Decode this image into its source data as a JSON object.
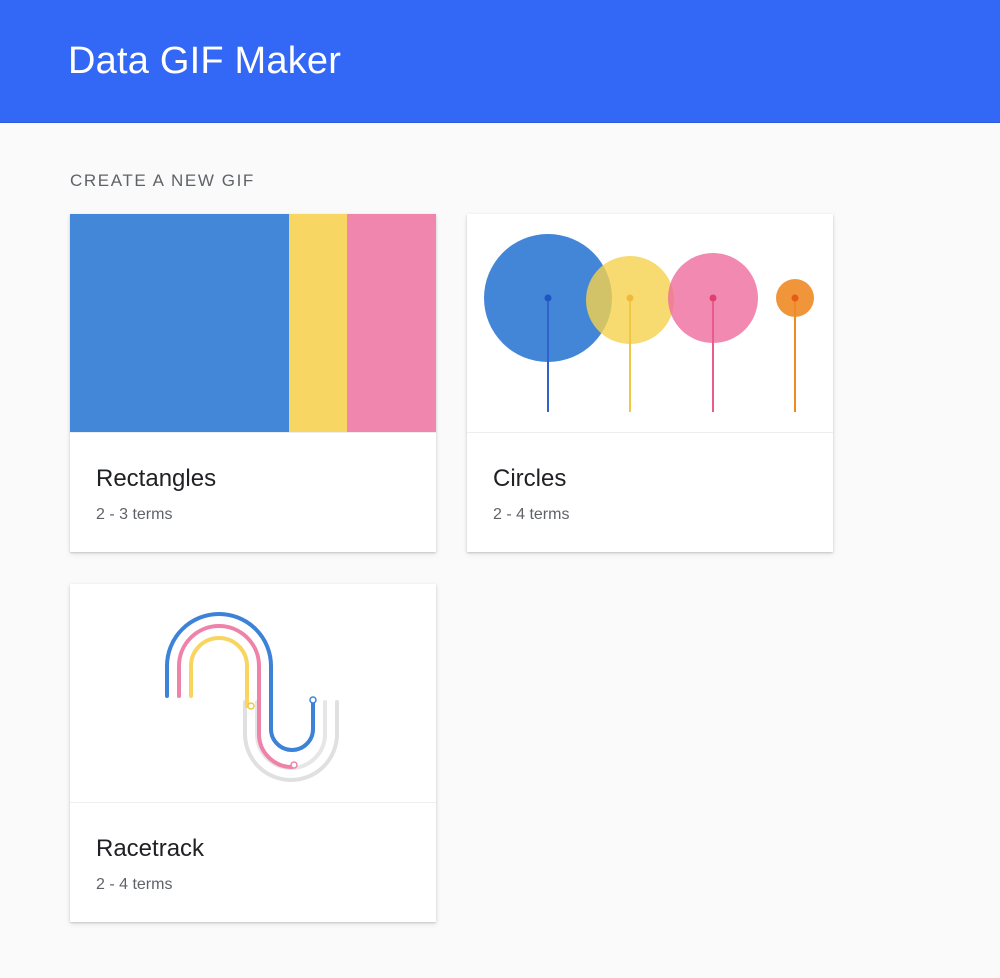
{
  "header": {
    "title": "Data GIF Maker"
  },
  "main": {
    "section_heading": "CREATE A NEW GIF",
    "cards": [
      {
        "title": "Rectangles",
        "subtitle": "2 - 3 terms",
        "thumbnail_icon": "rectangles-thumbnail"
      },
      {
        "title": "Circles",
        "subtitle": "2 - 4 terms",
        "thumbnail_icon": "circles-thumbnail"
      },
      {
        "title": "Racetrack",
        "subtitle": "2 - 4 terms",
        "thumbnail_icon": "racetrack-thumbnail"
      }
    ]
  },
  "colors": {
    "header_bg": "#3367f5",
    "blue": "#4285d9",
    "yellow": "#f7d560",
    "pink": "#f083ab",
    "orange": "#f0922f",
    "gray_track": "#e0e0e0"
  }
}
